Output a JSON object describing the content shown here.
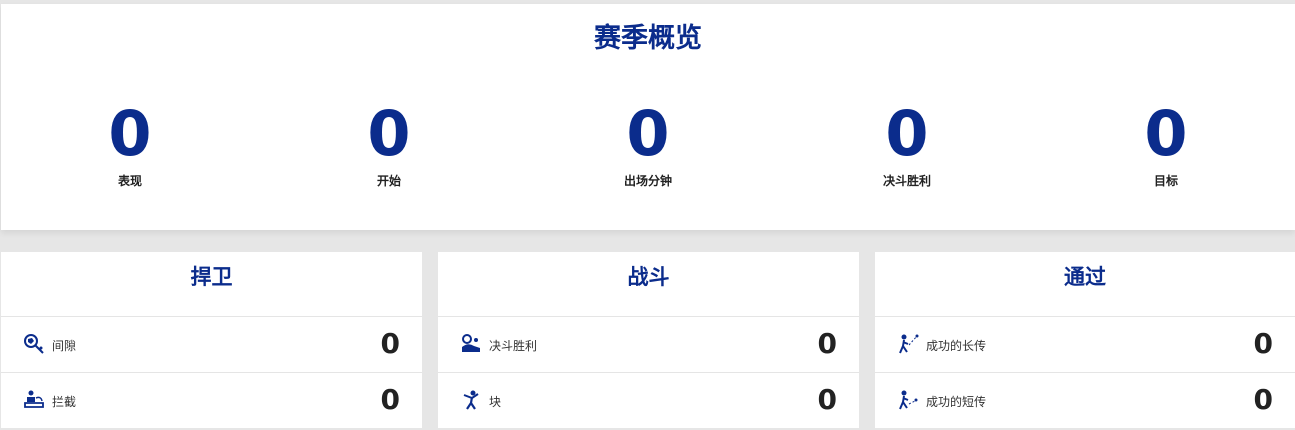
{
  "overview": {
    "title": "赛季概览",
    "stats": [
      {
        "value": "0",
        "label": "表现"
      },
      {
        "value": "0",
        "label": "开始"
      },
      {
        "value": "0",
        "label": "出场分钟"
      },
      {
        "value": "0",
        "label": "决斗胜利"
      },
      {
        "value": "0",
        "label": "目标"
      }
    ]
  },
  "cards": [
    {
      "title": "捍卫",
      "rows": [
        {
          "icon": "clearance-icon",
          "label": "间隙",
          "value": "0"
        },
        {
          "icon": "interception-icon",
          "label": "拦截",
          "value": "0"
        }
      ]
    },
    {
      "title": "战斗",
      "rows": [
        {
          "icon": "duel-won-icon",
          "label": "决斗胜利",
          "value": "0"
        },
        {
          "icon": "block-icon",
          "label": "块",
          "value": "0"
        }
      ]
    },
    {
      "title": "通过",
      "rows": [
        {
          "icon": "long-pass-icon",
          "label": "成功的长传",
          "value": "0"
        },
        {
          "icon": "short-pass-icon",
          "label": "成功的短传",
          "value": "0"
        }
      ]
    }
  ],
  "colors": {
    "accent": "#0b2c8c",
    "background": "#e6e6e6",
    "card": "#ffffff"
  }
}
